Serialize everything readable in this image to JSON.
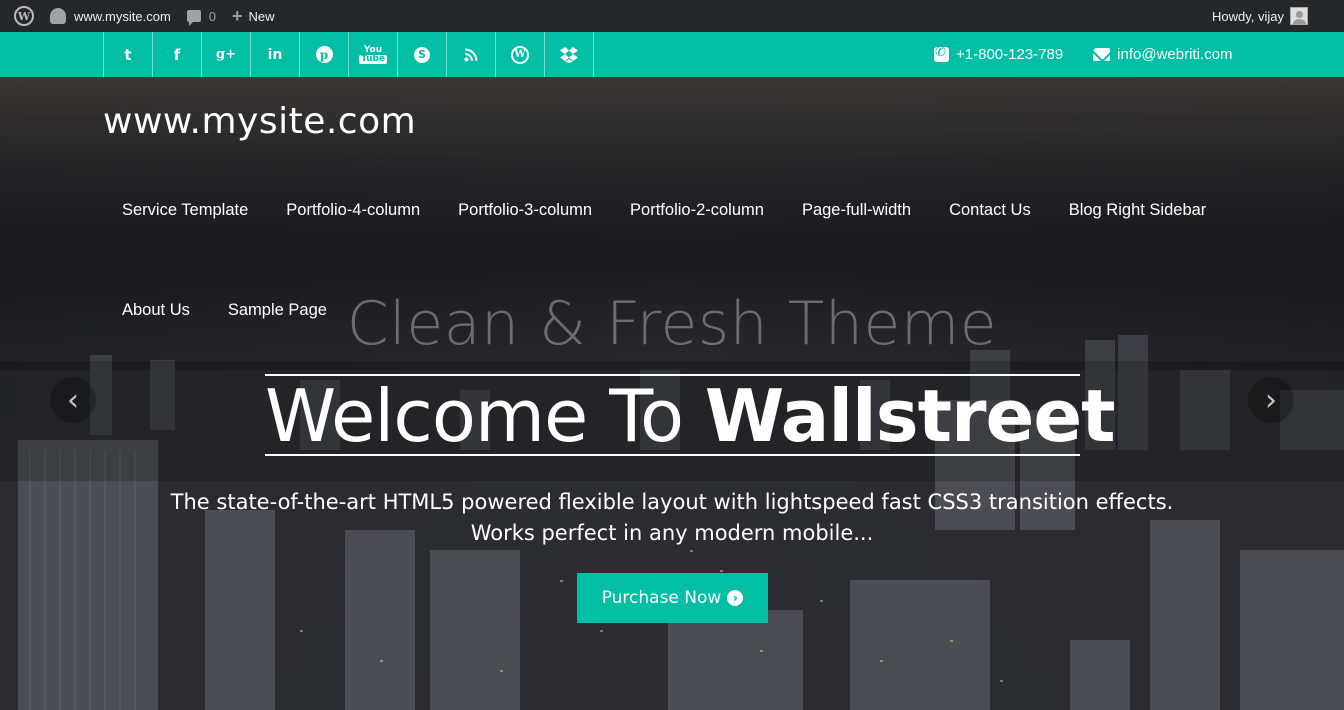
{
  "adminbar": {
    "site": "www.mysite.com",
    "comments_count": "0",
    "new_label": "New",
    "howdy": "Howdy, vijay"
  },
  "topbar": {
    "social_icons": [
      "twitter-icon",
      "facebook-icon",
      "google-plus-icon",
      "linkedin-icon",
      "pinterest-icon",
      "youtube-icon",
      "skype-icon",
      "rss-icon",
      "wordpress-icon",
      "dropbox-icon"
    ],
    "phone": "+1-800-123-789",
    "email": "info@webriti.com",
    "accent": "#00bfa5"
  },
  "header": {
    "site_title": "www.mysite.com"
  },
  "menu": {
    "items": [
      "Service Template",
      "Portfolio-4-column",
      "Portfolio-3-column",
      "Portfolio-2-column",
      "Page-full-width",
      "Contact Us",
      "Blog Right Sidebar",
      "About Us",
      "Sample Page"
    ]
  },
  "slider": {
    "subheading": "Clean & Fresh Theme",
    "heading_light": "Welcome To ",
    "heading_bold": "Wallstreet",
    "description": "The state-of-the-art HTML5 powered flexible layout with lightspeed fast CSS3 transition effects. Works perfect in any modern mobile...",
    "button_label": "Purchase Now",
    "prev_glyph": "‹",
    "next_glyph": "›"
  }
}
